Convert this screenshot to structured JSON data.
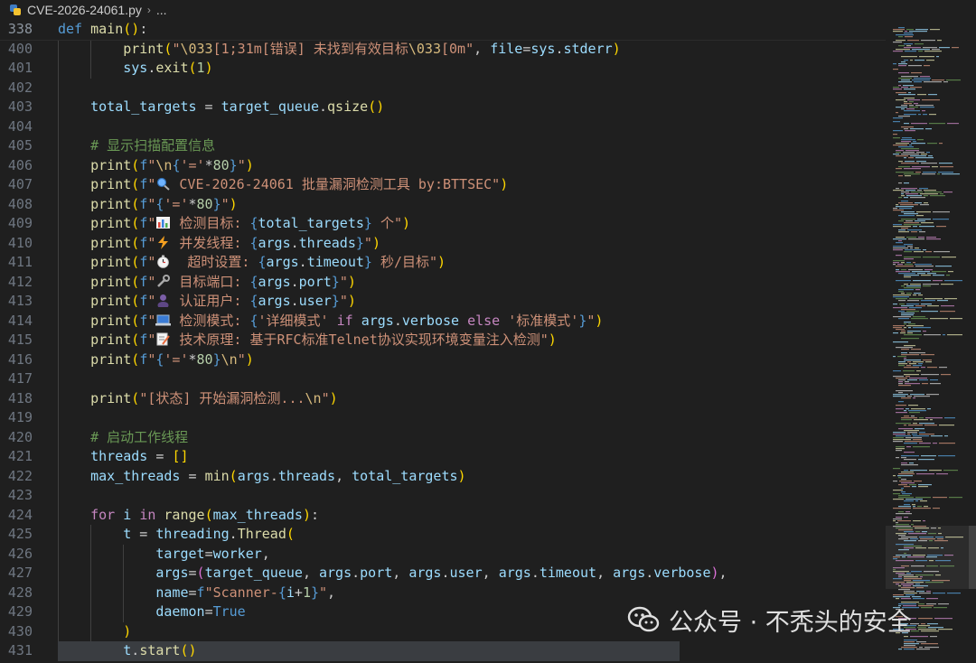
{
  "breadcrumb": {
    "file": "CVE-2026-24061.py",
    "separator": "›",
    "tail": "..."
  },
  "watermark": {
    "text": "公众号 · 不秃头的安全"
  },
  "colors": {
    "background": "#1f1f1f",
    "keyword": "#569cd6",
    "control": "#c586c0",
    "function": "#dcdcaa",
    "string": "#ce9178",
    "number": "#b5cea8",
    "comment": "#6a9955",
    "variable": "#9cdcfe"
  },
  "icons": [
    "python-file-icon",
    "magnifier-emoji",
    "bar-chart-emoji",
    "lightning-emoji",
    "stopwatch-emoji",
    "wrench-emoji",
    "user-emoji",
    "laptop-emoji",
    "memo-emoji",
    "wechat-icon"
  ],
  "lines": [
    {
      "n": "338",
      "tokens": [
        [
          "kw",
          "def"
        ],
        [
          "def",
          " "
        ],
        [
          "fn",
          "main"
        ],
        [
          "p1",
          "()"
        ],
        [
          "def",
          ":"
        ]
      ]
    },
    {
      "n": "400",
      "tokens": [
        [
          "def",
          "        "
        ],
        [
          "fn",
          "print"
        ],
        [
          "p1",
          "("
        ],
        [
          "str",
          "\""
        ],
        [
          "esc",
          "\\033"
        ],
        [
          "str",
          "[1;31m[错误] 未找到有效目标"
        ],
        [
          "esc",
          "\\033"
        ],
        [
          "str",
          "[0m\""
        ],
        [
          "def",
          ", "
        ],
        [
          "var",
          "file"
        ],
        [
          "def",
          "="
        ],
        [
          "var",
          "sys"
        ],
        [
          "def",
          "."
        ],
        [
          "var",
          "stderr"
        ],
        [
          "p1",
          ")"
        ]
      ]
    },
    {
      "n": "401",
      "tokens": [
        [
          "def",
          "        "
        ],
        [
          "var",
          "sys"
        ],
        [
          "def",
          "."
        ],
        [
          "fn",
          "exit"
        ],
        [
          "p1",
          "("
        ],
        [
          "num",
          "1"
        ],
        [
          "p1",
          ")"
        ]
      ]
    },
    {
      "n": "402",
      "tokens": []
    },
    {
      "n": "403",
      "tokens": [
        [
          "def",
          "    "
        ],
        [
          "var",
          "total_targets"
        ],
        [
          "def",
          " = "
        ],
        [
          "var",
          "target_queue"
        ],
        [
          "def",
          "."
        ],
        [
          "fn",
          "qsize"
        ],
        [
          "p1",
          "()"
        ]
      ]
    },
    {
      "n": "404",
      "tokens": []
    },
    {
      "n": "405",
      "tokens": [
        [
          "def",
          "    "
        ],
        [
          "com",
          "# 显示扫描配置信息"
        ]
      ]
    },
    {
      "n": "406",
      "tokens": [
        [
          "def",
          "    "
        ],
        [
          "fn",
          "print"
        ],
        [
          "p1",
          "("
        ],
        [
          "kw",
          "f"
        ],
        [
          "str",
          "\""
        ],
        [
          "esc",
          "\\n"
        ],
        [
          "brace",
          "{"
        ],
        [
          "str",
          "'='"
        ],
        [
          "def",
          "*"
        ],
        [
          "num",
          "80"
        ],
        [
          "brace",
          "}"
        ],
        [
          "str",
          "\""
        ],
        [
          "p1",
          ")"
        ]
      ]
    },
    {
      "n": "407",
      "tokens": [
        [
          "def",
          "    "
        ],
        [
          "fn",
          "print"
        ],
        [
          "p1",
          "("
        ],
        [
          "kw",
          "f"
        ],
        [
          "str",
          "\""
        ],
        [
          "emoji",
          "magnifier"
        ],
        [
          "str",
          " CVE-2026-24061 批量漏洞检测工具 by:BTTSEC\""
        ],
        [
          "p1",
          ")"
        ]
      ]
    },
    {
      "n": "408",
      "tokens": [
        [
          "def",
          "    "
        ],
        [
          "fn",
          "print"
        ],
        [
          "p1",
          "("
        ],
        [
          "kw",
          "f"
        ],
        [
          "str",
          "\""
        ],
        [
          "brace",
          "{"
        ],
        [
          "str",
          "'='"
        ],
        [
          "def",
          "*"
        ],
        [
          "num",
          "80"
        ],
        [
          "brace",
          "}"
        ],
        [
          "str",
          "\""
        ],
        [
          "p1",
          ")"
        ]
      ]
    },
    {
      "n": "409",
      "tokens": [
        [
          "def",
          "    "
        ],
        [
          "fn",
          "print"
        ],
        [
          "p1",
          "("
        ],
        [
          "kw",
          "f"
        ],
        [
          "str",
          "\""
        ],
        [
          "emoji",
          "chart"
        ],
        [
          "str",
          " 检测目标: "
        ],
        [
          "brace",
          "{"
        ],
        [
          "var",
          "total_targets"
        ],
        [
          "brace",
          "}"
        ],
        [
          "str",
          " 个\""
        ],
        [
          "p1",
          ")"
        ]
      ]
    },
    {
      "n": "410",
      "tokens": [
        [
          "def",
          "    "
        ],
        [
          "fn",
          "print"
        ],
        [
          "p1",
          "("
        ],
        [
          "kw",
          "f"
        ],
        [
          "str",
          "\""
        ],
        [
          "emoji",
          "bolt"
        ],
        [
          "str",
          " 并发线程: "
        ],
        [
          "brace",
          "{"
        ],
        [
          "var",
          "args"
        ],
        [
          "def",
          "."
        ],
        [
          "var",
          "threads"
        ],
        [
          "brace",
          "}"
        ],
        [
          "str",
          "\""
        ],
        [
          "p1",
          ")"
        ]
      ]
    },
    {
      "n": "411",
      "tokens": [
        [
          "def",
          "    "
        ],
        [
          "fn",
          "print"
        ],
        [
          "p1",
          "("
        ],
        [
          "kw",
          "f"
        ],
        [
          "str",
          "\""
        ],
        [
          "emoji",
          "watch"
        ],
        [
          "str",
          "  超时设置: "
        ],
        [
          "brace",
          "{"
        ],
        [
          "var",
          "args"
        ],
        [
          "def",
          "."
        ],
        [
          "var",
          "timeout"
        ],
        [
          "brace",
          "}"
        ],
        [
          "str",
          " 秒/目标\""
        ],
        [
          "p1",
          ")"
        ]
      ]
    },
    {
      "n": "412",
      "tokens": [
        [
          "def",
          "    "
        ],
        [
          "fn",
          "print"
        ],
        [
          "p1",
          "("
        ],
        [
          "kw",
          "f"
        ],
        [
          "str",
          "\""
        ],
        [
          "emoji",
          "wrench"
        ],
        [
          "str",
          " 目标端口: "
        ],
        [
          "brace",
          "{"
        ],
        [
          "var",
          "args"
        ],
        [
          "def",
          "."
        ],
        [
          "var",
          "port"
        ],
        [
          "brace",
          "}"
        ],
        [
          "str",
          "\""
        ],
        [
          "p1",
          ")"
        ]
      ]
    },
    {
      "n": "413",
      "tokens": [
        [
          "def",
          "    "
        ],
        [
          "fn",
          "print"
        ],
        [
          "p1",
          "("
        ],
        [
          "kw",
          "f"
        ],
        [
          "str",
          "\""
        ],
        [
          "emoji",
          "user"
        ],
        [
          "str",
          " 认证用户: "
        ],
        [
          "brace",
          "{"
        ],
        [
          "var",
          "args"
        ],
        [
          "def",
          "."
        ],
        [
          "var",
          "user"
        ],
        [
          "brace",
          "}"
        ],
        [
          "str",
          "\""
        ],
        [
          "p1",
          ")"
        ]
      ]
    },
    {
      "n": "414",
      "tokens": [
        [
          "def",
          "    "
        ],
        [
          "fn",
          "print"
        ],
        [
          "p1",
          "("
        ],
        [
          "kw",
          "f"
        ],
        [
          "str",
          "\""
        ],
        [
          "emoji",
          "laptop"
        ],
        [
          "str",
          " 检测模式: "
        ],
        [
          "brace",
          "{"
        ],
        [
          "str",
          "'详细模式'"
        ],
        [
          "def",
          " "
        ],
        [
          "kw2",
          "if"
        ],
        [
          "def",
          " "
        ],
        [
          "var",
          "args"
        ],
        [
          "def",
          "."
        ],
        [
          "var",
          "verbose"
        ],
        [
          "def",
          " "
        ],
        [
          "kw2",
          "else"
        ],
        [
          "def",
          " "
        ],
        [
          "str",
          "'标准模式'"
        ],
        [
          "brace",
          "}"
        ],
        [
          "str",
          "\""
        ],
        [
          "p1",
          ")"
        ]
      ]
    },
    {
      "n": "415",
      "tokens": [
        [
          "def",
          "    "
        ],
        [
          "fn",
          "print"
        ],
        [
          "p1",
          "("
        ],
        [
          "kw",
          "f"
        ],
        [
          "str",
          "\""
        ],
        [
          "emoji",
          "memo"
        ],
        [
          "str",
          " 技术原理: 基于RFC标准Telnet协议实现环境变量注入检测\""
        ],
        [
          "p1",
          ")"
        ]
      ]
    },
    {
      "n": "416",
      "tokens": [
        [
          "def",
          "    "
        ],
        [
          "fn",
          "print"
        ],
        [
          "p1",
          "("
        ],
        [
          "kw",
          "f"
        ],
        [
          "str",
          "\""
        ],
        [
          "brace",
          "{"
        ],
        [
          "str",
          "'='"
        ],
        [
          "def",
          "*"
        ],
        [
          "num",
          "80"
        ],
        [
          "brace",
          "}"
        ],
        [
          "esc",
          "\\n"
        ],
        [
          "str",
          "\""
        ],
        [
          "p1",
          ")"
        ]
      ]
    },
    {
      "n": "417",
      "tokens": []
    },
    {
      "n": "418",
      "tokens": [
        [
          "def",
          "    "
        ],
        [
          "fn",
          "print"
        ],
        [
          "p1",
          "("
        ],
        [
          "str",
          "\"[状态] 开始漏洞检测..."
        ],
        [
          "esc",
          "\\n"
        ],
        [
          "str",
          "\""
        ],
        [
          "p1",
          ")"
        ]
      ]
    },
    {
      "n": "419",
      "tokens": []
    },
    {
      "n": "420",
      "tokens": [
        [
          "def",
          "    "
        ],
        [
          "com",
          "# 启动工作线程"
        ]
      ]
    },
    {
      "n": "421",
      "tokens": [
        [
          "def",
          "    "
        ],
        [
          "var",
          "threads"
        ],
        [
          "def",
          " = "
        ],
        [
          "p1",
          "[]"
        ]
      ]
    },
    {
      "n": "422",
      "tokens": [
        [
          "def",
          "    "
        ],
        [
          "var",
          "max_threads"
        ],
        [
          "def",
          " = "
        ],
        [
          "fn",
          "min"
        ],
        [
          "p1",
          "("
        ],
        [
          "var",
          "args"
        ],
        [
          "def",
          "."
        ],
        [
          "var",
          "threads"
        ],
        [
          "def",
          ", "
        ],
        [
          "var",
          "total_targets"
        ],
        [
          "p1",
          ")"
        ]
      ]
    },
    {
      "n": "423",
      "tokens": []
    },
    {
      "n": "424",
      "tokens": [
        [
          "def",
          "    "
        ],
        [
          "kw2",
          "for"
        ],
        [
          "def",
          " "
        ],
        [
          "var",
          "i"
        ],
        [
          "def",
          " "
        ],
        [
          "kw2",
          "in"
        ],
        [
          "def",
          " "
        ],
        [
          "fn",
          "range"
        ],
        [
          "p1",
          "("
        ],
        [
          "var",
          "max_threads"
        ],
        [
          "p1",
          ")"
        ],
        [
          "def",
          ":"
        ]
      ]
    },
    {
      "n": "425",
      "tokens": [
        [
          "def",
          "        "
        ],
        [
          "var",
          "t"
        ],
        [
          "def",
          " = "
        ],
        [
          "var",
          "threading"
        ],
        [
          "def",
          "."
        ],
        [
          "fn",
          "Thread"
        ],
        [
          "p1",
          "("
        ]
      ]
    },
    {
      "n": "426",
      "tokens": [
        [
          "def",
          "            "
        ],
        [
          "var",
          "target"
        ],
        [
          "def",
          "="
        ],
        [
          "var",
          "worker"
        ],
        [
          "def",
          ","
        ]
      ]
    },
    {
      "n": "427",
      "tokens": [
        [
          "def",
          "            "
        ],
        [
          "var",
          "args"
        ],
        [
          "def",
          "="
        ],
        [
          "p2",
          "("
        ],
        [
          "var",
          "target_queue"
        ],
        [
          "def",
          ", "
        ],
        [
          "var",
          "args"
        ],
        [
          "def",
          "."
        ],
        [
          "var",
          "port"
        ],
        [
          "def",
          ", "
        ],
        [
          "var",
          "args"
        ],
        [
          "def",
          "."
        ],
        [
          "var",
          "user"
        ],
        [
          "def",
          ", "
        ],
        [
          "var",
          "args"
        ],
        [
          "def",
          "."
        ],
        [
          "var",
          "timeout"
        ],
        [
          "def",
          ", "
        ],
        [
          "var",
          "args"
        ],
        [
          "def",
          "."
        ],
        [
          "var",
          "verbose"
        ],
        [
          "p2",
          ")"
        ],
        [
          "def",
          ","
        ]
      ]
    },
    {
      "n": "428",
      "tokens": [
        [
          "def",
          "            "
        ],
        [
          "var",
          "name"
        ],
        [
          "def",
          "="
        ],
        [
          "kw",
          "f"
        ],
        [
          "str",
          "\"Scanner-"
        ],
        [
          "brace",
          "{"
        ],
        [
          "var",
          "i"
        ],
        [
          "def",
          "+"
        ],
        [
          "num",
          "1"
        ],
        [
          "brace",
          "}"
        ],
        [
          "str",
          "\""
        ],
        [
          "def",
          ","
        ]
      ]
    },
    {
      "n": "429",
      "tokens": [
        [
          "def",
          "            "
        ],
        [
          "var",
          "daemon"
        ],
        [
          "def",
          "="
        ],
        [
          "kw",
          "True"
        ]
      ]
    },
    {
      "n": "430",
      "tokens": [
        [
          "def",
          "        "
        ],
        [
          "p1",
          ")"
        ]
      ]
    },
    {
      "n": "431",
      "tokens": [
        [
          "def",
          "        "
        ],
        [
          "var",
          "t"
        ],
        [
          "def",
          "."
        ],
        [
          "fn",
          "start"
        ],
        [
          "p1",
          "()"
        ]
      ]
    }
  ]
}
